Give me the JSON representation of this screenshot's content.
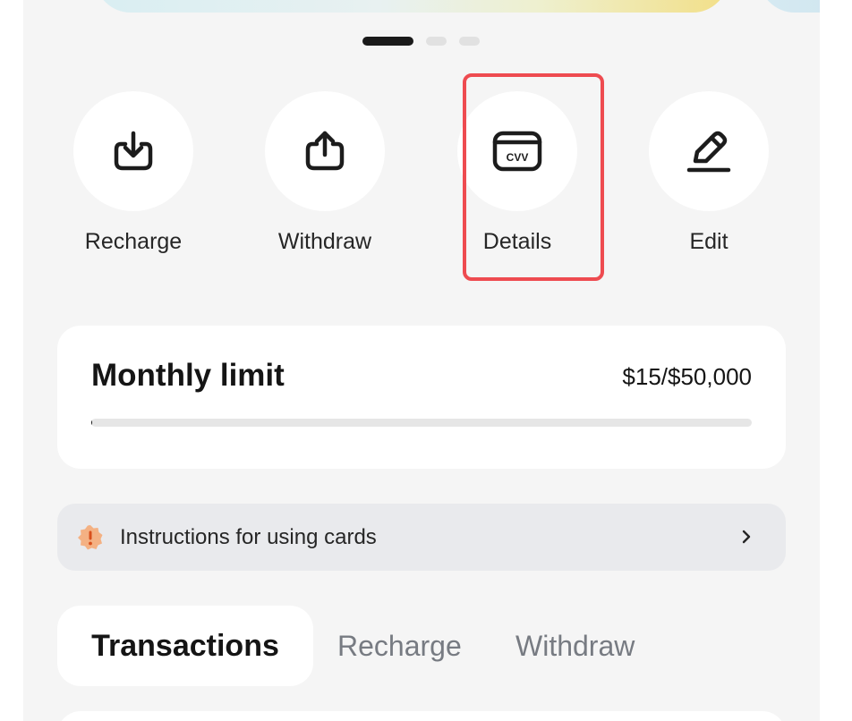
{
  "pager": {
    "count": 3,
    "active_index": 0
  },
  "actions": [
    {
      "label": "Recharge",
      "icon": "download-icon"
    },
    {
      "label": "Withdraw",
      "icon": "upload-icon"
    },
    {
      "label": "Details",
      "icon": "card-cvv-icon",
      "icon_text": "CVV",
      "highlighted": true
    },
    {
      "label": "Edit",
      "icon": "pencil-icon"
    }
  ],
  "monthly_limit": {
    "title": "Monthly limit",
    "value_text": "$15/$50,000",
    "used": 15,
    "limit": 50000
  },
  "instructions": {
    "text": "Instructions for using cards",
    "icon": "warning-badge-icon",
    "icon_color": "#f4b183"
  },
  "tabs": [
    {
      "label": "Transactions",
      "active": true
    },
    {
      "label": "Recharge",
      "active": false
    },
    {
      "label": "Withdraw",
      "active": false
    }
  ],
  "colors": {
    "highlight": "#ee4b50",
    "text_primary": "#151515",
    "text_secondary": "#777b82",
    "background": "#f5f5f5"
  }
}
